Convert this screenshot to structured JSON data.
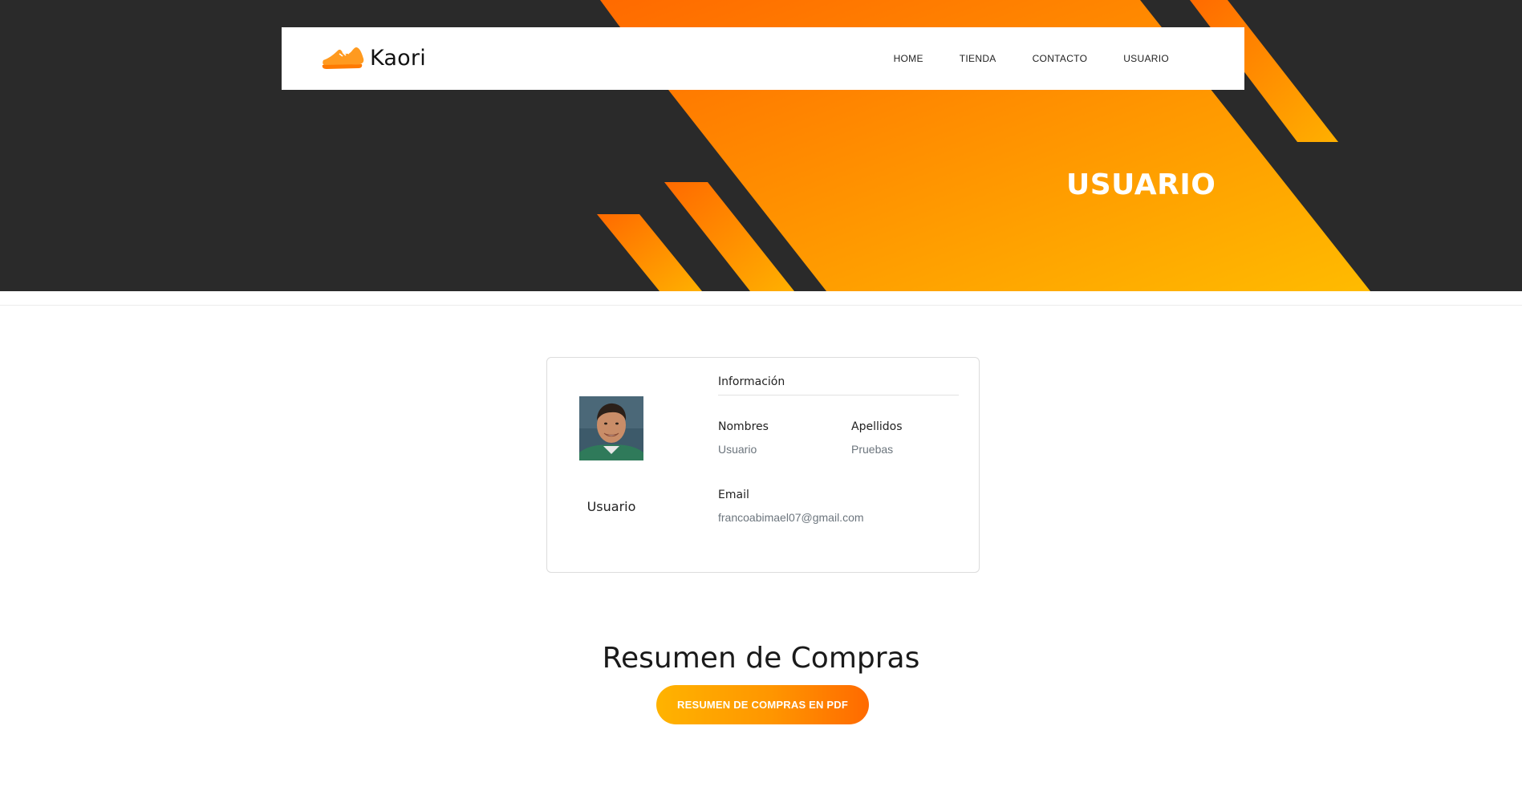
{
  "brand": {
    "name": "Kaori",
    "logo_icon": "sneaker-icon"
  },
  "nav": {
    "items": [
      {
        "label": "HOME"
      },
      {
        "label": "TIENDA"
      },
      {
        "label": "CONTACTO"
      },
      {
        "label": "USUARIO"
      }
    ]
  },
  "hero": {
    "title": "USUARIO"
  },
  "profile": {
    "display_name": "Usuario",
    "info_header": "Información",
    "fields": {
      "nombres": {
        "label": "Nombres",
        "value": "Usuario"
      },
      "apellidos": {
        "label": "Apellidos",
        "value": "Pruebas"
      },
      "email": {
        "label": "Email",
        "value": "francoabimael07@gmail.com"
      }
    }
  },
  "summary": {
    "title": "Resumen de Compras",
    "pdf_button_label": "RESUMEN DE COMPRAS EN PDF"
  },
  "colors": {
    "hero_dark": "#2a2a2a",
    "accent_orange": "#ff6a00",
    "accent_yellow": "#ffb300"
  }
}
